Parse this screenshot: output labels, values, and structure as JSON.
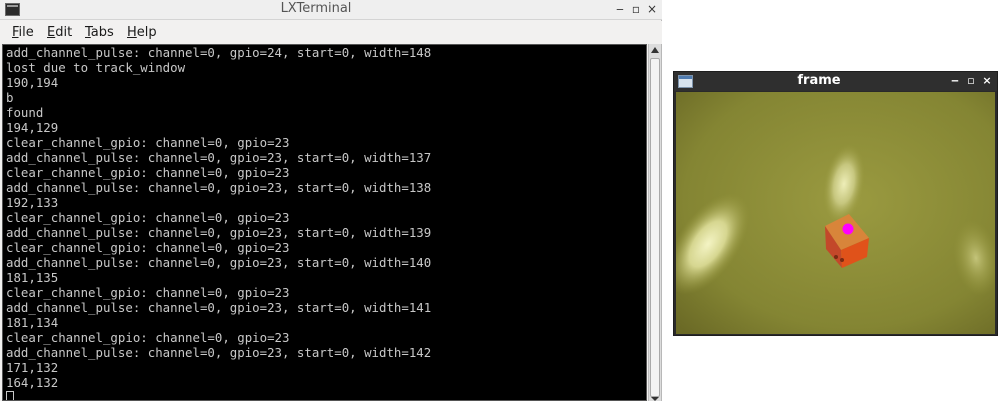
{
  "terminal": {
    "title": "LXTerminal",
    "window_buttons": {
      "minimize": "‒",
      "maximize": "▫",
      "close": "×"
    },
    "menu": [
      {
        "mnemonic": "F",
        "rest": "ile"
      },
      {
        "mnemonic": "E",
        "rest": "dit"
      },
      {
        "mnemonic": "T",
        "rest": "abs"
      },
      {
        "mnemonic": "H",
        "rest": "elp"
      }
    ],
    "lines": [
      "add_channel_pulse: channel=0, gpio=24, start=0, width=148",
      "lost due to track_window",
      "190,194",
      "b",
      "found",
      "194,129",
      "clear_channel_gpio: channel=0, gpio=23",
      "add_channel_pulse: channel=0, gpio=23, start=0, width=137",
      "clear_channel_gpio: channel=0, gpio=23",
      "add_channel_pulse: channel=0, gpio=23, start=0, width=138",
      "192,133",
      "clear_channel_gpio: channel=0, gpio=23",
      "add_channel_pulse: channel=0, gpio=23, start=0, width=139",
      "clear_channel_gpio: channel=0, gpio=23",
      "add_channel_pulse: channel=0, gpio=23, start=0, width=140",
      "181,135",
      "clear_channel_gpio: channel=0, gpio=23",
      "add_channel_pulse: channel=0, gpio=23, start=0, width=141",
      "181,134",
      "clear_channel_gpio: channel=0, gpio=23",
      "add_channel_pulse: channel=0, gpio=23, start=0, width=142",
      "171,132",
      "164,132"
    ]
  },
  "frame_window": {
    "title": "frame",
    "window_buttons": {
      "minimize": "‒",
      "maximize": "▫",
      "close": "×"
    },
    "colors": {
      "background": "#8d8c3b",
      "tracked_object": "#e0521a",
      "marker": "#ff00ff"
    }
  }
}
